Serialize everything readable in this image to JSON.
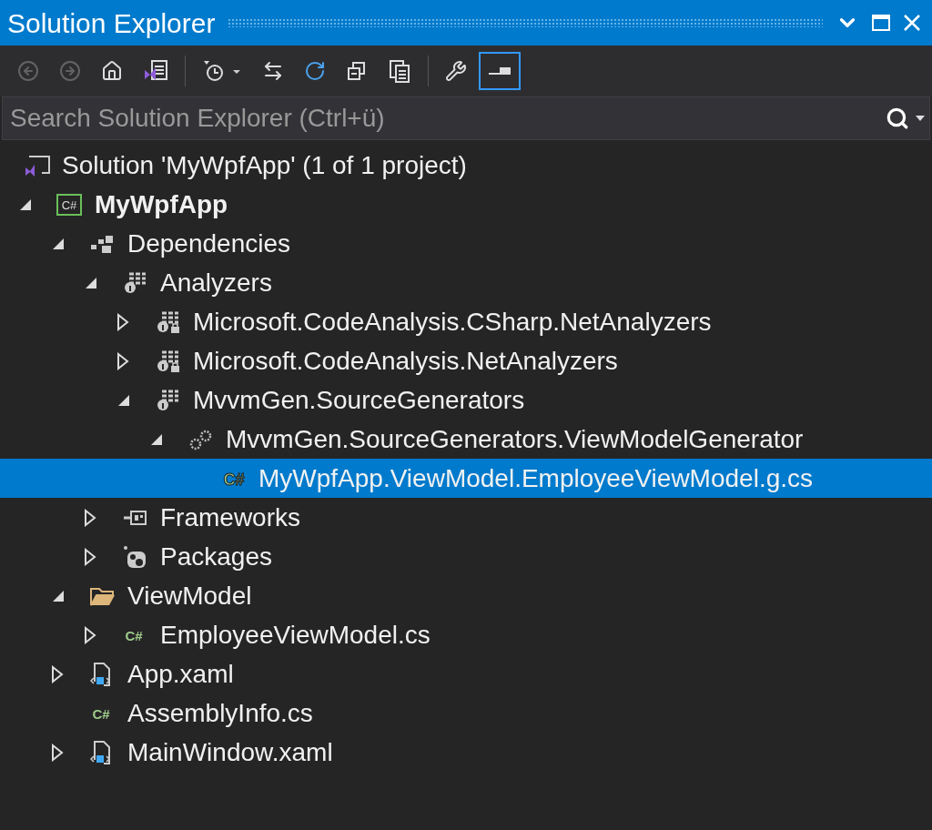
{
  "title_bar": {
    "title": "Solution Explorer"
  },
  "toolbar": [
    {
      "kind": "back",
      "disabled": true,
      "selected": false
    },
    {
      "kind": "forward",
      "disabled": true,
      "selected": false
    },
    {
      "kind": "home",
      "disabled": false,
      "selected": false
    },
    {
      "kind": "switch-views",
      "disabled": false,
      "selected": false
    },
    {
      "kind": "separator"
    },
    {
      "kind": "pending-filter",
      "disabled": false,
      "selected": false
    },
    {
      "kind": "sync",
      "disabled": false,
      "selected": false
    },
    {
      "kind": "refresh",
      "disabled": false,
      "selected": false
    },
    {
      "kind": "collapse-all",
      "disabled": false,
      "selected": false
    },
    {
      "kind": "show-all-files",
      "disabled": false,
      "selected": false
    },
    {
      "kind": "separator"
    },
    {
      "kind": "properties",
      "disabled": false,
      "selected": false
    },
    {
      "kind": "preview",
      "disabled": false,
      "selected": true
    }
  ],
  "search": {
    "placeholder": "Search Solution Explorer (Ctrl+ü)"
  },
  "tree": [
    {
      "label": "Solution 'MyWpfApp' (1 of 1 project)",
      "kind": "solution",
      "selected": false,
      "bold": false,
      "children": [
        {
          "label": "MyWpfApp",
          "kind": "project",
          "glyph": "C#",
          "expandable": true,
          "expanded": true,
          "selected": false,
          "bold": true,
          "children": [
            {
              "label": "Dependencies",
              "kind": "dependencies",
              "expandable": true,
              "expanded": true,
              "selected": false,
              "bold": false,
              "children": [
                {
                  "label": "Analyzers",
                  "kind": "analyzer",
                  "expandable": true,
                  "expanded": true,
                  "selected": false,
                  "bold": false,
                  "children": [
                    {
                      "label": "Microsoft.CodeAnalysis.CSharp.NetAnalyzers",
                      "kind": "analyzer-locked",
                      "expandable": true,
                      "expanded": false,
                      "selected": false,
                      "bold": false
                    },
                    {
                      "label": "Microsoft.CodeAnalysis.NetAnalyzers",
                      "kind": "analyzer-locked",
                      "expandable": true,
                      "expanded": false,
                      "selected": false,
                      "bold": false
                    },
                    {
                      "label": "MvvmGen.SourceGenerators",
                      "kind": "analyzer",
                      "expandable": true,
                      "expanded": true,
                      "selected": false,
                      "bold": false,
                      "children": [
                        {
                          "label": "MvvmGen.SourceGenerators.ViewModelGenerator",
                          "kind": "generator",
                          "expandable": true,
                          "expanded": true,
                          "selected": false,
                          "bold": false,
                          "children": [
                            {
                              "label": "MyWpfApp.ViewModel.EmployeeViewModel.g.cs",
                              "kind": "csharp-generated",
                              "glyph": "C#",
                              "expandable": false,
                              "selected": true,
                              "bold": false
                            }
                          ]
                        }
                      ]
                    }
                  ]
                },
                {
                  "label": "Frameworks",
                  "kind": "frameworks",
                  "expandable": true,
                  "expanded": false,
                  "selected": false,
                  "bold": false
                },
                {
                  "label": "Packages",
                  "kind": "packages",
                  "expandable": true,
                  "expanded": false,
                  "selected": false,
                  "bold": false
                }
              ]
            },
            {
              "label": "ViewModel",
              "kind": "folder",
              "expandable": true,
              "expanded": true,
              "selected": false,
              "bold": false,
              "children": [
                {
                  "label": "EmployeeViewModel.cs",
                  "kind": "csharp",
                  "glyph": "C#",
                  "expandable": true,
                  "expanded": false,
                  "selected": false,
                  "bold": false
                }
              ]
            },
            {
              "label": "App.xaml",
              "kind": "xaml",
              "expandable": true,
              "expanded": false,
              "selected": false,
              "bold": false
            },
            {
              "label": "AssemblyInfo.cs",
              "kind": "csharp",
              "glyph": "C#",
              "expandable": false,
              "selected": false,
              "bold": false
            },
            {
              "label": "MainWindow.xaml",
              "kind": "xaml",
              "expandable": true,
              "expanded": false,
              "selected": false,
              "bold": false
            }
          ]
        }
      ]
    }
  ]
}
